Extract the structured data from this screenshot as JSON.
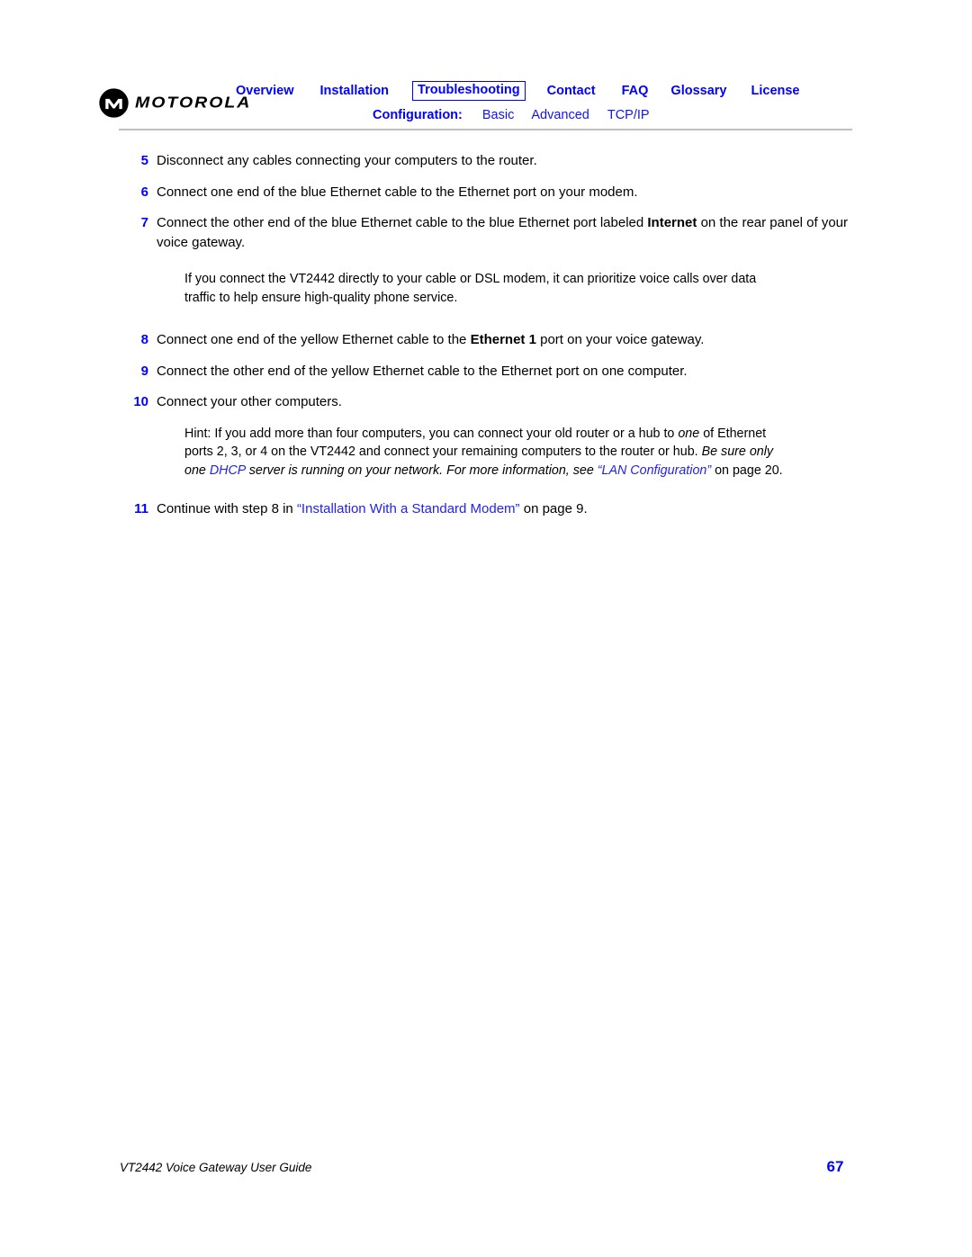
{
  "header": {
    "logo": {
      "icon": "motorola-m-logo-icon",
      "wordmark": "MOTOROLA"
    },
    "nav": [
      {
        "label": "Overview",
        "active": false
      },
      {
        "label": "Installation",
        "active": false
      },
      {
        "label": "Troubleshooting",
        "active": true
      },
      {
        "label": "Contact",
        "active": false
      },
      {
        "label": "FAQ",
        "active": false
      },
      {
        "label": "Glossary",
        "active": false
      },
      {
        "label": "License",
        "active": false
      }
    ],
    "config": {
      "label": "Configuration:",
      "items": [
        {
          "label": "Basic"
        },
        {
          "label": "Advanced"
        },
        {
          "label": "TCP/IP"
        }
      ]
    }
  },
  "body": {
    "steps": [
      {
        "num": "5",
        "parts": [
          {
            "t": "Disconnect any cables connecting your computers to the router.",
            "s": "plain"
          }
        ]
      },
      {
        "num": "6",
        "parts": [
          {
            "t": "Connect one end of the blue Ethernet cable to the Ethernet port on your modem.",
            "s": "plain"
          }
        ]
      },
      {
        "num": "7",
        "parts": [
          {
            "t": "Connect the other end of the blue Ethernet cable to the blue Ethernet port labeled ",
            "s": "plain"
          },
          {
            "t": "Internet",
            "s": "bold"
          },
          {
            "t": " on the rear panel of your voice gateway.",
            "s": "plain"
          }
        ]
      },
      {
        "num": "8",
        "parts": [
          {
            "t": "Connect one end of the yellow Ethernet cable to the ",
            "s": "plain"
          },
          {
            "t": "Ethernet 1",
            "s": "bold"
          },
          {
            "t": " port on your voice gateway.",
            "s": "plain"
          }
        ]
      },
      {
        "num": "9",
        "parts": [
          {
            "t": "Connect the other end of the yellow Ethernet cable to the Ethernet port on one computer.",
            "s": "plain"
          }
        ]
      },
      {
        "num": "10",
        "parts": [
          {
            "t": "Connect your other computers.",
            "s": "plain"
          }
        ]
      },
      {
        "num": "11",
        "parts": [
          {
            "t": "Continue with step 8 in ",
            "s": "plain"
          },
          {
            "t": "“Installation With a Standard Modem”",
            "s": "link"
          },
          {
            "t": " on page 9.",
            "s": "plain"
          }
        ]
      }
    ],
    "note_modem": {
      "parts": [
        {
          "t": "If you connect the VT2442 directly to your cable or DSL modem, it can prioritize voice calls over data traffic to help ensure high-quality phone service.",
          "s": "plain"
        }
      ]
    },
    "note_hint": {
      "parts": [
        {
          "t": "Hint: If you add more than four computers, you can connect your old router or a hub to ",
          "s": "plain"
        },
        {
          "t": "one",
          "s": "italic"
        },
        {
          "t": " of Ethernet ports 2, 3, or 4 on the VT2442 and connect your remaining computers to the router or hub. ",
          "s": "plain"
        },
        {
          "t": "Be sure only one ",
          "s": "italic"
        },
        {
          "t": "DHCP",
          "s": "link-italic"
        },
        {
          "t": " server is running on your network. For more information, see ",
          "s": "italic"
        },
        {
          "t": "“LAN Configuration”",
          "s": "link-italic"
        },
        {
          "t": " on page 20.",
          "s": "plain"
        }
      ]
    }
  },
  "footer": {
    "guide_title": "VT2442 Voice Gateway User Guide",
    "page_number": "67"
  },
  "colors": {
    "link_blue": "#0000ff",
    "soft_link_blue": "#2222ee",
    "rule_gray": "#bfbfbf",
    "text_black": "#000000"
  }
}
